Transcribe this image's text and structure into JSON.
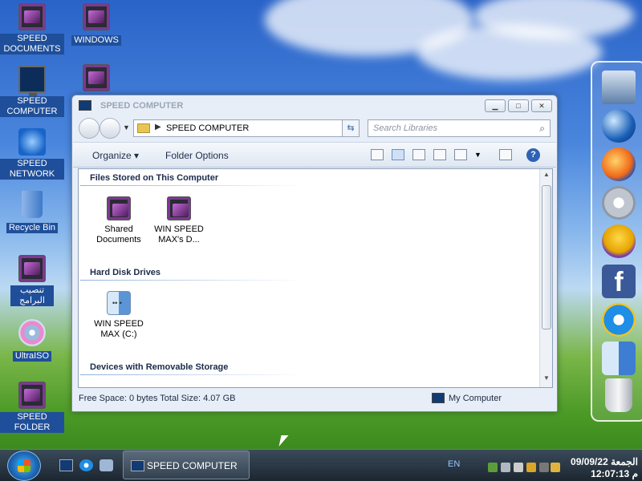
{
  "desktop": {
    "icons": [
      {
        "label": "SPEED DOCUMENTS",
        "icon": "documents-folder-icon"
      },
      {
        "label": "WINDOWS",
        "icon": "folder-icon"
      },
      {
        "label": "SPEED COMPUTER",
        "icon": "computer-monitor-icon"
      },
      {
        "label": "SPEED NETWORK",
        "icon": "network-icon"
      },
      {
        "label": "Recycle Bin",
        "icon": "recycle-bin-icon"
      },
      {
        "label": "تنصيب البرامج",
        "icon": "folder-icon"
      },
      {
        "label": "UltraISO",
        "icon": "disc-icon"
      },
      {
        "label": "SPEED FOLDER",
        "icon": "folder-icon"
      }
    ]
  },
  "window": {
    "title": "SPEED COMPUTER",
    "caption_buttons": [
      "minimize",
      "maximize",
      "close"
    ],
    "address": {
      "path": "SPEED COMPUTER"
    },
    "search": {
      "placeholder": "Search Libraries"
    },
    "toolbar": {
      "organize": "Organize",
      "folder_options": "Folder Options"
    },
    "groups": {
      "stored": {
        "title": "Files Stored on This Computer",
        "items": [
          "Shared Documents",
          "WIN SPEED MAX's D..."
        ]
      },
      "disks": {
        "title": "Hard Disk Drives",
        "items": [
          "WIN SPEED MAX (C:)"
        ]
      },
      "removable": {
        "title": "Devices with Removable Storage"
      }
    },
    "status": {
      "left": "Free Space: 0 bytes Total Size: 4.07 GB",
      "right": "My Computer"
    }
  },
  "dock": [
    "computer-icon",
    "globe-icon",
    "firefox-icon",
    "settings-gear-icon",
    "yahoo-messenger-icon",
    "facebook-icon",
    "internet-explorer-icon",
    "finder-icon",
    "trash-icon"
  ],
  "taskbar": {
    "active_window": "SPEED COMPUTER",
    "language": "EN",
    "clock_day": "الجمعة",
    "clock_date": "09/09/22",
    "clock_time": "12:07:13",
    "clock_ampm": "م"
  },
  "colors": {
    "accent": "#1f4f9a",
    "window_bg": "#e7eef8"
  }
}
